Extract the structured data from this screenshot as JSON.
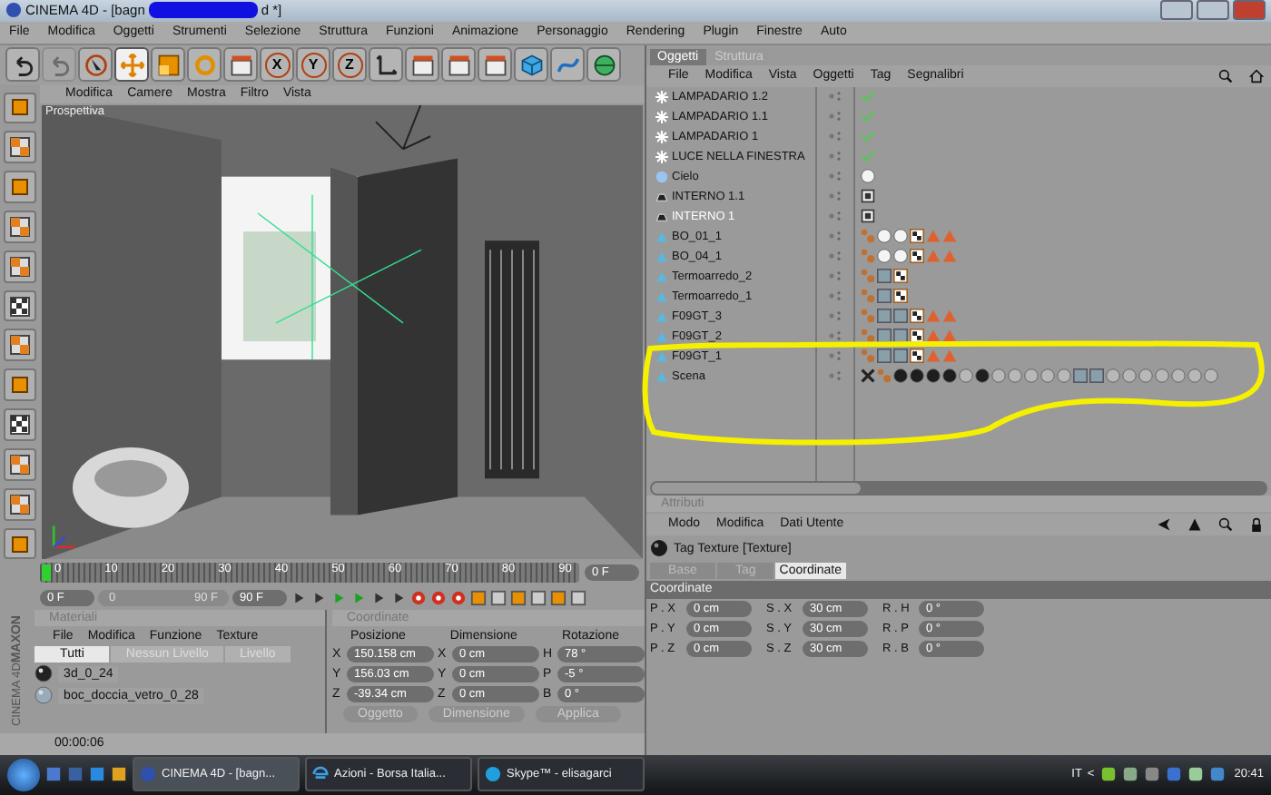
{
  "window": {
    "title_start": "CINEMA 4D - [bagn",
    "title_end": "d *]"
  },
  "menubar": [
    "File",
    "Modifica",
    "Oggetti",
    "Strumenti",
    "Selezione",
    "Struttura",
    "Funzioni",
    "Animazione",
    "Personaggio",
    "Rendering",
    "Plugin",
    "Finestre",
    "Auto"
  ],
  "toolbar": [
    {
      "kind": "undo",
      "selected": false,
      "disabled": false
    },
    {
      "kind": "redo",
      "selected": false,
      "disabled": true
    },
    {
      "kind": "select",
      "selected": false,
      "disabled": false
    },
    {
      "kind": "move",
      "selected": true,
      "disabled": false
    },
    {
      "kind": "scale",
      "selected": false,
      "disabled": false
    },
    {
      "kind": "rotate",
      "selected": false,
      "disabled": false
    },
    {
      "kind": "clapper",
      "selected": false,
      "disabled": false
    },
    {
      "kind": "axis",
      "label": "X",
      "selected": false,
      "disabled": false
    },
    {
      "kind": "axis",
      "label": "Y",
      "selected": false,
      "disabled": false
    },
    {
      "kind": "axis",
      "label": "Z",
      "selected": false,
      "disabled": false
    },
    {
      "kind": "coords",
      "selected": false,
      "disabled": false
    },
    {
      "kind": "clapper",
      "selected": false,
      "disabled": false
    },
    {
      "kind": "clapper",
      "selected": false,
      "disabled": false
    },
    {
      "kind": "clapper",
      "selected": false,
      "disabled": false
    },
    {
      "kind": "cube",
      "selected": false,
      "disabled": false
    },
    {
      "kind": "spline",
      "selected": false,
      "disabled": false
    },
    {
      "kind": "nurbs",
      "selected": false,
      "disabled": false
    }
  ],
  "viewport": {
    "menu": [
      "Modifica",
      "Camere",
      "Mostra",
      "Filtro",
      "Vista"
    ],
    "label": "Prospettiva"
  },
  "timeline": {
    "ticks": [
      "0",
      "10",
      "20",
      "30",
      "40",
      "50",
      "60",
      "70",
      "80",
      "90"
    ],
    "current": "0 F"
  },
  "transport": {
    "start": "0 F",
    "range_start": "0",
    "range_end": "90 F",
    "end": "90 F",
    "level": 1
  },
  "logo": {
    "line1": "MAXON",
    "line2": "CINEMA 4D"
  },
  "materials": {
    "title": "Materiali",
    "menu": [
      "File",
      "Modifica",
      "Funzione",
      "Texture"
    ],
    "tabs": [
      {
        "label": "Tutti",
        "selected": true
      },
      {
        "label": "Nessun Livello",
        "selected": false
      },
      {
        "label": "Livello",
        "selected": false
      }
    ],
    "items": [
      {
        "name": "3d_0_24",
        "kind": "dark"
      },
      {
        "name": "boc_doccia_vetro_0_28",
        "kind": "glass"
      }
    ]
  },
  "coordinates": {
    "title": "Coordinate",
    "headers": [
      "Posizione",
      "Dimensione",
      "Rotazione"
    ],
    "rows": [
      [
        {
          "axis": "X",
          "value": "150.158 cm"
        },
        {
          "axis": "X",
          "value": "0 cm"
        },
        {
          "axis": "H",
          "value": "78 °"
        }
      ],
      [
        {
          "axis": "Y",
          "value": "156.03 cm"
        },
        {
          "axis": "Y",
          "value": "0 cm"
        },
        {
          "axis": "P",
          "value": "-5 °"
        }
      ],
      [
        {
          "axis": "Z",
          "value": "-39.34 cm"
        },
        {
          "axis": "Z",
          "value": "0 cm"
        },
        {
          "axis": "B",
          "value": "0 °"
        }
      ]
    ],
    "dropdowns": [
      "Oggetto",
      "Dimensione"
    ],
    "apply": "Applica"
  },
  "status": "00:00:06",
  "objects": {
    "tabs": [
      {
        "label": "Oggetti",
        "selected": true
      },
      {
        "label": "Struttura",
        "selected": false
      }
    ],
    "menu": [
      "File",
      "Modifica",
      "Vista",
      "Oggetti",
      "Tag",
      "Segnalibri"
    ],
    "rows": [
      {
        "name": "LAMPADARIO 1.2",
        "kind": "light",
        "selected": false,
        "tags": [
          {
            "kind": "check"
          }
        ]
      },
      {
        "name": "LAMPADARIO 1.1",
        "kind": "light",
        "selected": false,
        "tags": [
          {
            "kind": "check"
          }
        ]
      },
      {
        "name": "LAMPADARIO 1",
        "kind": "light",
        "selected": false,
        "tags": [
          {
            "kind": "check"
          }
        ]
      },
      {
        "name": "LUCE NELLA FINESTRA",
        "kind": "light",
        "selected": false,
        "tags": [
          {
            "kind": "check"
          }
        ]
      },
      {
        "name": "Cielo",
        "kind": "sky",
        "selected": false,
        "tags": [
          {
            "kind": "white"
          }
        ]
      },
      {
        "name": "INTERNO 1.1",
        "kind": "floor",
        "selected": false,
        "tags": [
          {
            "kind": "grid"
          }
        ]
      },
      {
        "name": "INTERNO 1",
        "kind": "floor",
        "selected": true,
        "tags": [
          {
            "kind": "grid"
          }
        ]
      },
      {
        "name": "BO_01_1",
        "kind": "polygon",
        "selected": false,
        "tags": [
          {
            "kind": "phong"
          },
          {
            "kind": "white"
          },
          {
            "kind": "white"
          },
          {
            "kind": "checker"
          },
          {
            "kind": "triangle"
          },
          {
            "kind": "triangle"
          }
        ]
      },
      {
        "name": "BO_04_1",
        "kind": "polygon",
        "selected": false,
        "tags": [
          {
            "kind": "phong"
          },
          {
            "kind": "white"
          },
          {
            "kind": "white"
          },
          {
            "kind": "checker"
          },
          {
            "kind": "triangle"
          },
          {
            "kind": "triangle"
          }
        ]
      },
      {
        "name": "Termoarredo_2",
        "kind": "polygon",
        "selected": false,
        "tags": [
          {
            "kind": "phong"
          },
          {
            "kind": "glass"
          },
          {
            "kind": "checker"
          }
        ]
      },
      {
        "name": "Termoarredo_1",
        "kind": "polygon",
        "selected": false,
        "tags": [
          {
            "kind": "phong"
          },
          {
            "kind": "glass"
          },
          {
            "kind": "checker"
          }
        ]
      },
      {
        "name": "F09GT_3",
        "kind": "polygon",
        "selected": false,
        "tags": [
          {
            "kind": "phong"
          },
          {
            "kind": "glass"
          },
          {
            "kind": "glass"
          },
          {
            "kind": "checker"
          },
          {
            "kind": "triangle"
          },
          {
            "kind": "triangle"
          }
        ]
      },
      {
        "name": "F09GT_2",
        "kind": "polygon",
        "selected": false,
        "tags": [
          {
            "kind": "phong"
          },
          {
            "kind": "glass"
          },
          {
            "kind": "glass"
          },
          {
            "kind": "checker"
          },
          {
            "kind": "triangle"
          },
          {
            "kind": "triangle"
          }
        ]
      },
      {
        "name": "F09GT_1",
        "kind": "polygon",
        "selected": false,
        "tags": [
          {
            "kind": "phong"
          },
          {
            "kind": "glass"
          },
          {
            "kind": "glass"
          },
          {
            "kind": "checker"
          },
          {
            "kind": "triangle"
          },
          {
            "kind": "triangle"
          }
        ]
      },
      {
        "name": "Scena",
        "kind": "polygon",
        "selected": false,
        "tags": [
          {
            "kind": "cross"
          },
          {
            "kind": "phong"
          },
          {
            "kind": "dark"
          },
          {
            "kind": "dark"
          },
          {
            "kind": "dark"
          },
          {
            "kind": "dark"
          },
          {
            "kind": "grey"
          },
          {
            "kind": "dark"
          },
          {
            "kind": "grey"
          },
          {
            "kind": "grey"
          },
          {
            "kind": "grey"
          },
          {
            "kind": "grey"
          },
          {
            "kind": "grey"
          },
          {
            "kind": "glass"
          },
          {
            "kind": "glass"
          },
          {
            "kind": "grey"
          },
          {
            "kind": "grey"
          },
          {
            "kind": "grey"
          },
          {
            "kind": "grey"
          },
          {
            "kind": "grey"
          },
          {
            "kind": "grey"
          },
          {
            "kind": "grey"
          }
        ]
      }
    ]
  },
  "attributes": {
    "title": "Attributi",
    "menu": [
      "Modo",
      "Modifica",
      "Dati Utente"
    ],
    "object": "Tag Texture [Texture]",
    "tabs": [
      {
        "label": "Base",
        "selected": false
      },
      {
        "label": "Tag",
        "selected": false
      },
      {
        "label": "Coordinate",
        "selected": true
      }
    ],
    "section": "Coordinate",
    "rows": [
      [
        {
          "label": "P . X",
          "value": "0 cm"
        },
        {
          "label": "S . X",
          "value": "30 cm"
        },
        {
          "label": "R . H",
          "value": "0 °"
        }
      ],
      [
        {
          "label": "P . Y",
          "value": "0 cm"
        },
        {
          "label": "S . Y",
          "value": "30 cm"
        },
        {
          "label": "R . P",
          "value": "0 °"
        }
      ],
      [
        {
          "label": "P . Z",
          "value": "0 cm"
        },
        {
          "label": "S . Z",
          "value": "30 cm"
        },
        {
          "label": "R . B",
          "value": "0 °"
        }
      ]
    ]
  },
  "taskbar": {
    "tasks": [
      {
        "label": "CINEMA 4D - [bagn...",
        "kind": "sphere",
        "selected": true
      },
      {
        "label": "Azioni - Borsa Italia...",
        "kind": "browser",
        "selected": false
      },
      {
        "label": "Skype™ - elisagarci",
        "kind": "chat",
        "selected": false
      }
    ],
    "language": "IT",
    "expand": "<",
    "clock": "20:41"
  }
}
